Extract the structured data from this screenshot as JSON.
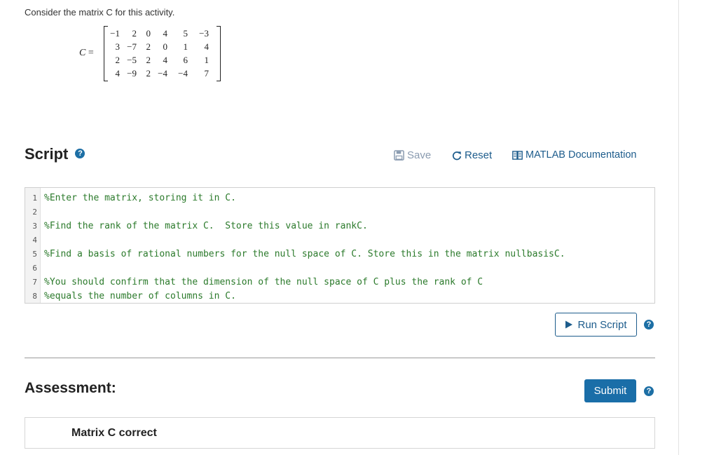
{
  "intro_text": "Consider the matrix C for this activity.",
  "matrix": {
    "label": "C",
    "equals": "=",
    "rows": [
      [
        "−1",
        "2",
        "0",
        "4",
        "5",
        "−3"
      ],
      [
        "3",
        "−7",
        "2",
        "0",
        "1",
        "4"
      ],
      [
        "2",
        "−5",
        "2",
        "4",
        "6",
        "1"
      ],
      [
        "4",
        "−9",
        "2",
        "−4",
        "−4",
        "7"
      ]
    ]
  },
  "script_section": {
    "title": "Script",
    "help_glyph": "?",
    "toolbar": {
      "save_label": "Save",
      "reset_label": "Reset",
      "docs_label": "MATLAB Documentation"
    }
  },
  "editor": {
    "lines": [
      {
        "num": "1",
        "text": "%Enter the matrix, storing it in C."
      },
      {
        "num": "2",
        "text": ""
      },
      {
        "num": "3",
        "text": "%Find the rank of the matrix C.  Store this value in rankC."
      },
      {
        "num": "4",
        "text": ""
      },
      {
        "num": "5",
        "text": "%Find a basis of rational numbers for the null space of C. Store this in the matrix nullbasisC."
      },
      {
        "num": "6",
        "text": ""
      },
      {
        "num": "7",
        "text": "%You should confirm that the dimension of the null space of C plus the rank of C"
      },
      {
        "num": "8",
        "text": "%equals the number of columns in C."
      }
    ]
  },
  "run_button_label": "Run Script",
  "assessment": {
    "title": "Assessment:",
    "submit_label": "Submit",
    "results": [
      {
        "label": "Matrix C correct"
      }
    ]
  },
  "colors": {
    "accent": "#1a6ea8",
    "comment_green": "#2b7a2b",
    "save_disabled": "#8a9bb0"
  },
  "icons": {
    "save": "save-disk-icon",
    "reset": "reset-arrow-icon",
    "docs": "book-icon",
    "run": "play-triangle-icon",
    "help": "question-circle-icon"
  }
}
